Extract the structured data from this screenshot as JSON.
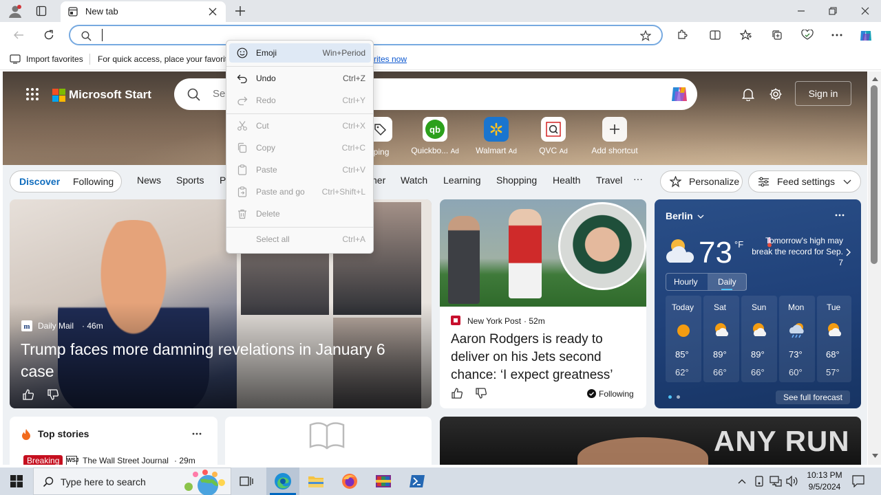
{
  "browser": {
    "tab_title": "New tab",
    "address_value": "",
    "favorites_bar": {
      "import_label": "Import favorites",
      "quick_access_text": "For quick access, place your favorit",
      "link_suffix": "rites now"
    }
  },
  "context_menu": {
    "items": [
      {
        "label": "Emoji",
        "shortcut": "Win+Period",
        "enabled": true,
        "icon": "emoji-icon"
      },
      {
        "label": "Undo",
        "shortcut": "Ctrl+Z",
        "enabled": true,
        "icon": "undo-icon"
      },
      {
        "label": "Redo",
        "shortcut": "Ctrl+Y",
        "enabled": false,
        "icon": "redo-icon"
      },
      {
        "label": "Cut",
        "shortcut": "Ctrl+X",
        "enabled": false,
        "icon": "cut-icon"
      },
      {
        "label": "Copy",
        "shortcut": "Ctrl+C",
        "enabled": false,
        "icon": "copy-icon"
      },
      {
        "label": "Paste",
        "shortcut": "Ctrl+V",
        "enabled": false,
        "icon": "paste-icon"
      },
      {
        "label": "Paste and go",
        "shortcut": "Ctrl+Shift+L",
        "enabled": false,
        "icon": "paste-go-icon"
      },
      {
        "label": "Delete",
        "shortcut": "",
        "enabled": false,
        "icon": "delete-icon"
      },
      {
        "label": "Select all",
        "shortcut": "Ctrl+A",
        "enabled": false,
        "icon": ""
      }
    ]
  },
  "start": {
    "brand": "Microsoft Start",
    "search_placeholder": "Se",
    "sign_in": "Sign in",
    "shortcuts": [
      {
        "label": "pping",
        "ad": ""
      },
      {
        "label": "Quickbo...",
        "ad": "Ad"
      },
      {
        "label": "Walmart",
        "ad": "Ad"
      },
      {
        "label": "QVC",
        "ad": "Ad"
      },
      {
        "label": "Add shortcut",
        "ad": ""
      }
    ],
    "nav": {
      "discover": "Discover",
      "following": "Following",
      "items": [
        "News",
        "Sports",
        "P",
        "her",
        "Watch",
        "Learning",
        "Shopping",
        "Health",
        "Travel"
      ],
      "more": "···",
      "personalize": "Personalize",
      "feed_settings": "Feed settings"
    },
    "main_story": {
      "source": "Daily Mail",
      "age": "46m",
      "headline": "Trump faces more damning revelations in January 6 case"
    },
    "second_story": {
      "source": "New York Post",
      "age": "52m",
      "headline": "Aaron Rodgers is ready to deliver on his Jets second chance: ‘I expect greatness’",
      "following": "Following"
    },
    "weather": {
      "city": "Berlin",
      "temp": "73",
      "unit": "°F",
      "alert": "Tomorrow's high may break the record for Sep. 7",
      "tabs": [
        "Hourly",
        "Daily"
      ],
      "days": [
        {
          "day": "Today",
          "hi": "85°",
          "lo": "62°",
          "icon": "sun-icon"
        },
        {
          "day": "Sat",
          "hi": "89°",
          "lo": "66°",
          "icon": "partly-sunny-icon"
        },
        {
          "day": "Sun",
          "hi": "89°",
          "lo": "66°",
          "icon": "partly-sunny-icon"
        },
        {
          "day": "Mon",
          "hi": "73°",
          "lo": "60°",
          "icon": "rain-icon"
        },
        {
          "day": "Tue",
          "hi": "68°",
          "lo": "57°",
          "icon": "partly-sunny-icon"
        }
      ],
      "see_full": "See full forecast"
    },
    "top_stories": {
      "title": "Top stories",
      "badge": "Breaking",
      "source": "The Wall Street Journal",
      "age": "29m"
    },
    "watermark": "ANY RUN"
  },
  "taskbar": {
    "search_placeholder": "Type here to search",
    "time": "10:13 PM",
    "date": "9/5/2024"
  }
}
